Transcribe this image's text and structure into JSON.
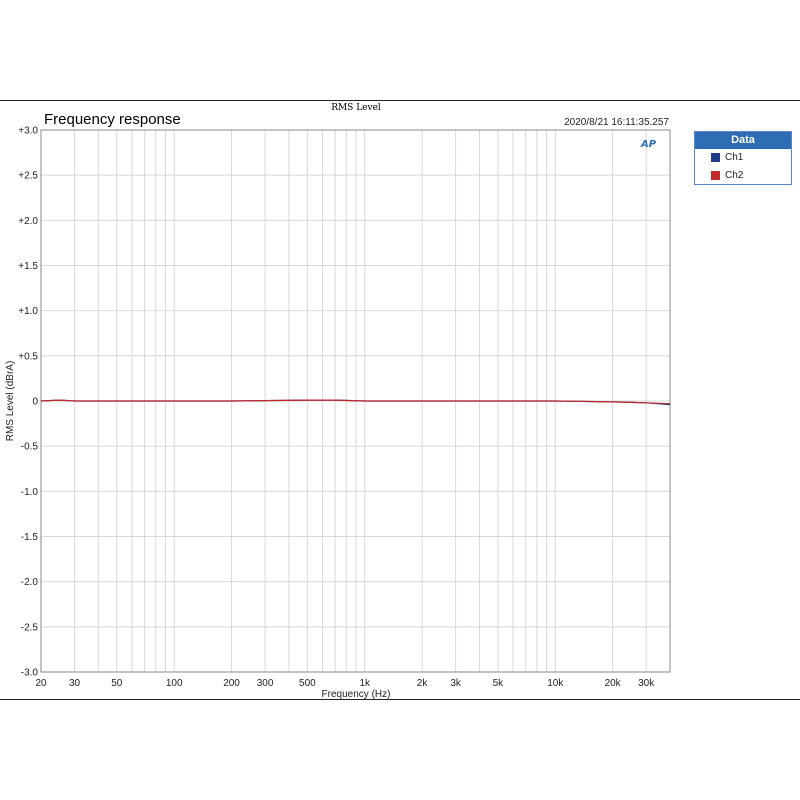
{
  "header": {
    "top_title": "RMS Level",
    "title": "Frequency response",
    "timestamp": "2020/8/21 16:11:35.257",
    "logo": "AP"
  },
  "legend": {
    "title": "Data",
    "items": [
      {
        "label": "Ch1",
        "color": "#1f3c88"
      },
      {
        "label": "Ch2",
        "color": "#c0282a"
      }
    ]
  },
  "chart_data": {
    "type": "line",
    "title": "Frequency response",
    "xlabel": "Frequency (Hz)",
    "ylabel": "RMS Level (dBrA)",
    "x_scale": "log",
    "xlim": [
      20,
      40000
    ],
    "ylim": [
      -3.0,
      3.0
    ],
    "grid": true,
    "legend_position": "right",
    "x_ticks": [
      {
        "value": 20,
        "label": "20"
      },
      {
        "value": 30,
        "label": "30"
      },
      {
        "value": 50,
        "label": "50"
      },
      {
        "value": 100,
        "label": "100"
      },
      {
        "value": 200,
        "label": "200"
      },
      {
        "value": 300,
        "label": "300"
      },
      {
        "value": 500,
        "label": "500"
      },
      {
        "value": 1000,
        "label": "1k"
      },
      {
        "value": 2000,
        "label": "2k"
      },
      {
        "value": 3000,
        "label": "3k"
      },
      {
        "value": 5000,
        "label": "5k"
      },
      {
        "value": 10000,
        "label": "10k"
      },
      {
        "value": 20000,
        "label": "20k"
      },
      {
        "value": 30000,
        "label": "30k"
      }
    ],
    "y_ticks": [
      {
        "value": 3.0,
        "label": "+3.0"
      },
      {
        "value": 2.5,
        "label": "+2.5"
      },
      {
        "value": 2.0,
        "label": "+2.0"
      },
      {
        "value": 1.5,
        "label": "+1.5"
      },
      {
        "value": 1.0,
        "label": "+1.0"
      },
      {
        "value": 0.5,
        "label": "+0.5"
      },
      {
        "value": 0,
        "label": "0"
      },
      {
        "value": -0.5,
        "label": "-0.5"
      },
      {
        "value": -1.0,
        "label": "-1.0"
      },
      {
        "value": -1.5,
        "label": "-1.5"
      },
      {
        "value": -2.0,
        "label": "-2.0"
      },
      {
        "value": -2.5,
        "label": "-2.5"
      },
      {
        "value": -3.0,
        "label": "-3.0"
      }
    ],
    "series": [
      {
        "name": "Ch1",
        "color": "#1f3c88",
        "x": [
          20,
          25,
          30,
          50,
          100,
          200,
          500,
          700,
          1000,
          2000,
          5000,
          10000,
          20000,
          30000,
          40000
        ],
        "y": [
          0.0,
          0.01,
          0.0,
          0.0,
          0.0,
          0.0,
          0.01,
          0.01,
          0.0,
          0.0,
          0.0,
          0.0,
          -0.01,
          -0.02,
          -0.04
        ]
      },
      {
        "name": "Ch2",
        "color": "#c0282a",
        "x": [
          20,
          25,
          30,
          50,
          100,
          200,
          500,
          700,
          1000,
          2000,
          5000,
          10000,
          20000,
          30000,
          40000
        ],
        "y": [
          0.0,
          0.01,
          0.0,
          0.0,
          0.0,
          0.0,
          0.01,
          0.01,
          0.0,
          0.0,
          0.0,
          0.0,
          -0.01,
          -0.02,
          -0.03
        ]
      }
    ]
  }
}
